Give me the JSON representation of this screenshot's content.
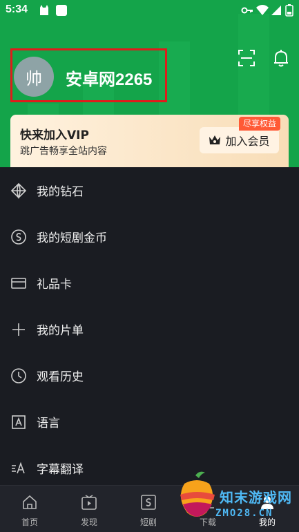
{
  "status_bar": {
    "time": "5:34"
  },
  "profile": {
    "avatar_text": "帅",
    "username": "安卓网2265"
  },
  "vip": {
    "title": "快来加入VIP",
    "subtitle": "跳广告畅享全站内容",
    "badge": "尽享权益",
    "button_label": "加入会员"
  },
  "menu": {
    "items": [
      {
        "label": "我的钻石",
        "icon": "diamond-icon"
      },
      {
        "label": "我的短剧金币",
        "icon": "coin-icon"
      },
      {
        "label": "礼品卡",
        "icon": "gift-card-icon"
      },
      {
        "label": "我的片单",
        "icon": "plus-icon"
      },
      {
        "label": "观看历史",
        "icon": "clock-icon"
      },
      {
        "label": "语言",
        "icon": "language-icon"
      },
      {
        "label": "字幕翻译",
        "icon": "subtitle-translate-icon"
      }
    ]
  },
  "bottom_nav": {
    "items": [
      {
        "label": "首页",
        "icon": "home-icon"
      },
      {
        "label": "发现",
        "icon": "discover-icon"
      },
      {
        "label": "短剧",
        "icon": "short-drama-icon"
      },
      {
        "label": "下载",
        "icon": "download-icon"
      },
      {
        "label": "我的",
        "icon": "profile-icon",
        "active": true
      }
    ]
  },
  "watermark": {
    "title": "知末游戏网",
    "subtitle": "ZMO28.CN"
  },
  "colors": {
    "header_green": "#14a44a",
    "background": "#1a1c22",
    "highlight_border": "#e01b1b",
    "badge_orange": "#ff5a36",
    "watermark_blue": "#4fb9f5"
  }
}
